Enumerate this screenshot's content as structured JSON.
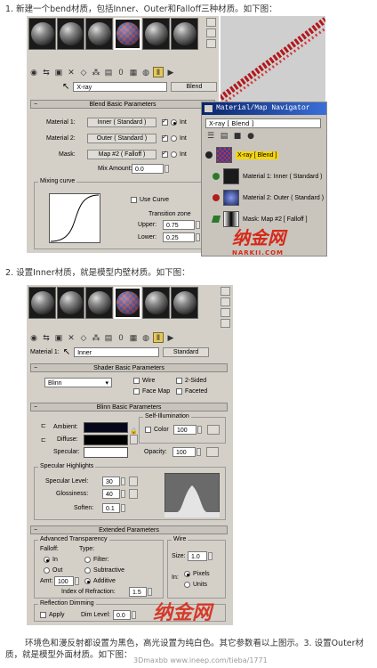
{
  "captions": {
    "step1": "1. 新建一个bend材质，包括Inner、Outer和Falloff三种材质。如下图：",
    "step2": "2. 设置Inner材质，就是模型内壁材质。如下图：",
    "step3": "环境色和漫反射都设置为黑色，高光设置为纯白色。其它参数看以上图示。3. 设置Outer材质，就是模型外面材质。如下图："
  },
  "shot1": {
    "material_name": "X-ray",
    "type_button": "Blend",
    "rollout_title": "Blend Basic Parameters",
    "rows": [
      {
        "label": "Material 1:",
        "button": "Inner  ( Standard )",
        "suffix": "Int"
      },
      {
        "label": "Material 2:",
        "button": "Outer  ( Standard )",
        "suffix": "Int"
      },
      {
        "label": "Mask:",
        "button": "Map #2  ( Falloff )",
        "suffix": "Int"
      }
    ],
    "mix_amount_label": "Mix Amount:",
    "mix_amount": "0.0",
    "mixing_curve_label": "Mixing curve",
    "use_curve_label": "Use Curve",
    "transition_zone_label": "Transition zone",
    "upper_label": "Upper:",
    "upper": "0.75",
    "lower_label": "Lower:",
    "lower": "0.25"
  },
  "navigator": {
    "title": "Material/Map Navigator",
    "field": "X-ray  [ Blend ]",
    "items": [
      {
        "label": "X-ray  [ Blend ]",
        "color": "#2a2a2a"
      },
      {
        "label": "Material 1: Inner  ( Standard )",
        "color": "#2b7a2b"
      },
      {
        "label": "Material 2: Outer  ( Standard )",
        "color": "#b21e1e"
      },
      {
        "label": "Mask: Map #2  [ Falloff ]",
        "color": "#2b7a2b"
      }
    ]
  },
  "watermark": {
    "text": "纳金网",
    "sub": "NARKII.COM"
  },
  "shot2": {
    "slot_label": "Material 1:",
    "material_name": "Inner",
    "type_button": "Standard",
    "shader_rollout": "Shader Basic Parameters",
    "shader": "Blinn",
    "shader_options": [
      "Wire",
      "2-Sided",
      "Face Map",
      "Faceted"
    ],
    "blinn_rollout": "Blinn Basic Parameters",
    "self_illum_label": "Self-Illumination",
    "color_label": "Color",
    "color_value": "100",
    "opacity_label": "Opacity:",
    "opacity_value": "100",
    "ambient_label": "Ambient:",
    "diffuse_label": "Diffuse:",
    "specular_label": "Specular:",
    "spec_highlights_label": "Specular Highlights",
    "spec_level_label": "Specular Level:",
    "spec_level": "30",
    "glossiness_label": "Glossiness:",
    "glossiness": "40",
    "soften_label": "Soften:",
    "soften": "0.1",
    "extended_rollout": "Extended Parameters",
    "adv_transparency_label": "Advanced Transparency",
    "falloff_label": "Falloff:",
    "type_label": "Type:",
    "in_label": "In",
    "out_label": "Out",
    "filter_label": "Filter:",
    "subtractive_label": "Subtractive",
    "additive_label": "Additive",
    "amt_label": "Amt:",
    "amt_value": "100",
    "ior_label": "Index of Refraction:",
    "ior_value": "1.5",
    "wire_label": "Wire",
    "size_label": "Size:",
    "size_value": "1.0",
    "wire_in_label": "In:",
    "pixels_label": "Pixels",
    "units_label": "Units",
    "reflection_dimming_label": "Reflection Dimming",
    "apply_label": "Apply",
    "dim_level_label": "Dim Level:",
    "dim_level": "0.0"
  },
  "colors": {
    "ambient": "#06081a",
    "diffuse": "#000000",
    "specular": "#ffffff",
    "panel": "#d4d0c8",
    "nav_title": "#0a246a"
  },
  "footer_watermark": "3Dmaxbb  www.ineep.com/tieba/1771"
}
